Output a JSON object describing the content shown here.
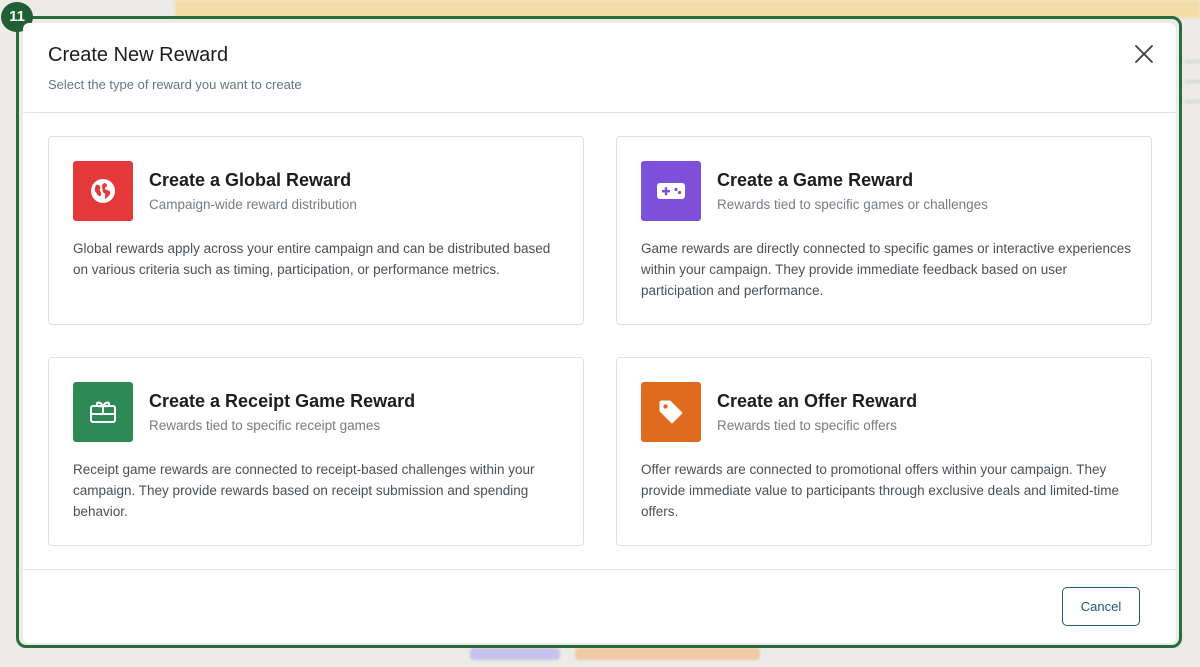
{
  "dialog": {
    "badge": "11",
    "title": "Create New Reward",
    "subtitle": "Select the type of reward you want to create",
    "close_icon": "close-icon",
    "cancel_label": "Cancel"
  },
  "cards": [
    {
      "title": "Create a Global Reward",
      "subtitle": "Campaign-wide reward distribution",
      "description": "Global rewards apply across your entire campaign and can be distributed based on various criteria such as timing, participation, or performance metrics.",
      "icon": "globe-icon",
      "color": "#e3393a"
    },
    {
      "title": "Create a Game Reward",
      "subtitle": "Rewards tied to specific games or challenges",
      "description": "Game rewards are directly connected to specific games or interactive experiences within your campaign. They provide immediate feedback based on user participation and performance.",
      "icon": "gamepad-icon",
      "color": "#7e4fd8"
    },
    {
      "title": "Create a Receipt Game Reward",
      "subtitle": "Rewards tied to specific receipt games",
      "description": "Receipt game rewards are connected to receipt-based challenges within your campaign. They provide rewards based on receipt submission and spending behavior.",
      "icon": "gift-card-icon",
      "color": "#2e8a55"
    },
    {
      "title": "Create an Offer Reward",
      "subtitle": "Rewards tied to specific offers",
      "description": "Offer rewards are connected to promotional offers within your campaign. They provide immediate value to participants through exclusive deals and limited-time offers.",
      "icon": "tag-icon",
      "color": "#e06a1e"
    }
  ]
}
